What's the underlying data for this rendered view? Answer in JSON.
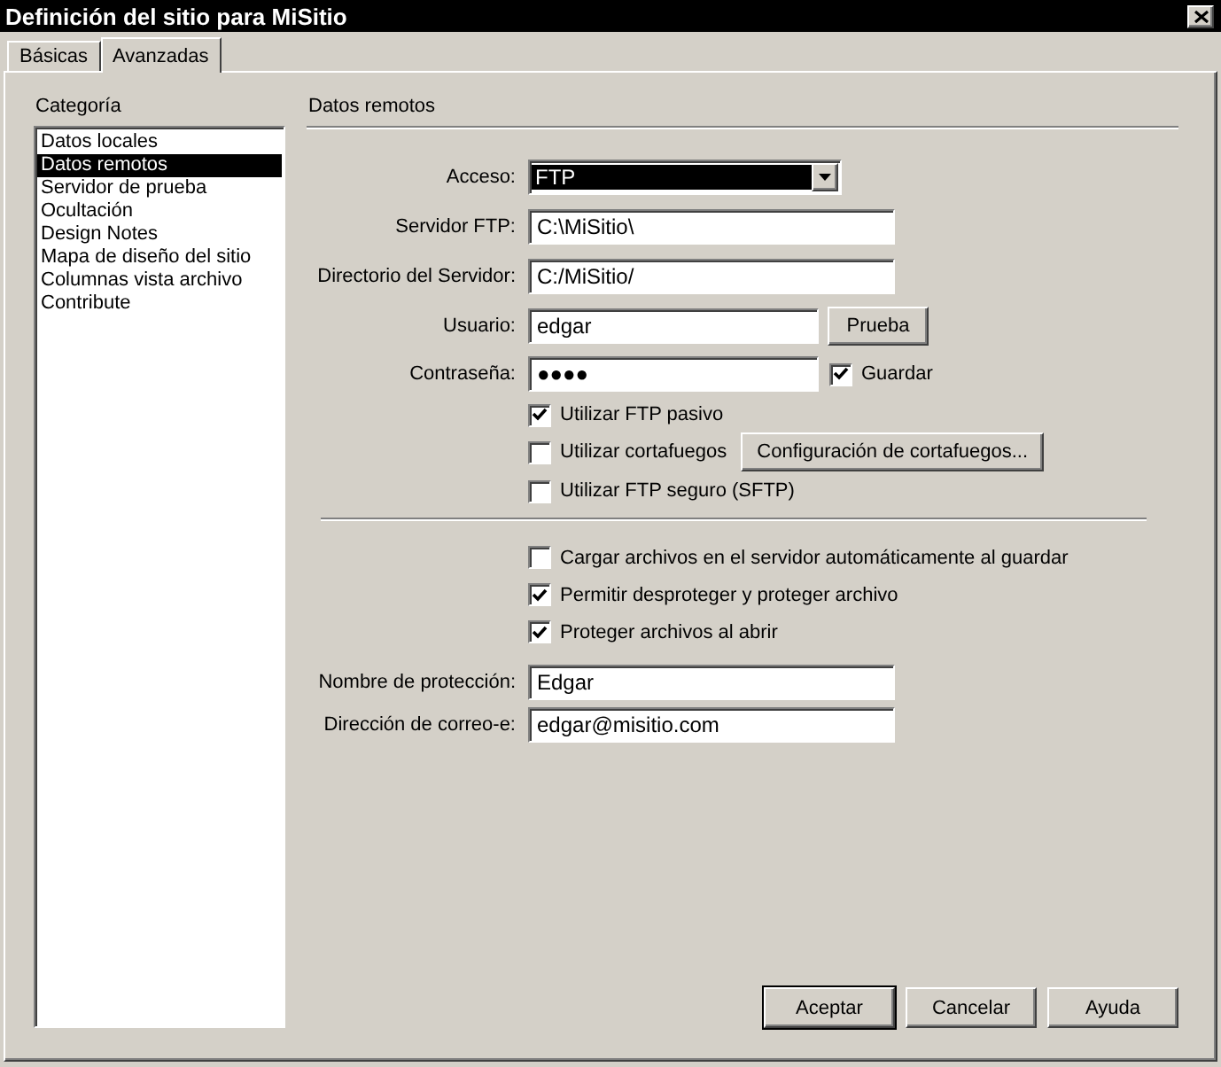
{
  "window": {
    "title": "Definición del sitio para MiSitio"
  },
  "tabs": [
    {
      "label": "Básicas",
      "selected": false
    },
    {
      "label": "Avanzadas",
      "selected": true
    }
  ],
  "category": {
    "label": "Categoría",
    "items": [
      {
        "label": "Datos locales",
        "selected": false
      },
      {
        "label": "Datos remotos",
        "selected": true
      },
      {
        "label": "Servidor de prueba",
        "selected": false
      },
      {
        "label": "Ocultación",
        "selected": false
      },
      {
        "label": "Design Notes",
        "selected": false
      },
      {
        "label": "Mapa de diseño del sitio",
        "selected": false
      },
      {
        "label": "Columnas vista archivo",
        "selected": false
      },
      {
        "label": "Contribute",
        "selected": false
      }
    ]
  },
  "section": {
    "title": "Datos remotos"
  },
  "server_fields": [
    {
      "kind": "select",
      "label": "Acceso:",
      "value": "FTP"
    },
    {
      "kind": "text",
      "label": "Servidor FTP:",
      "value": "C:\\MiSitio\\"
    },
    {
      "kind": "text",
      "label": "Directorio del Servidor:",
      "value": "C:/MiSitio/"
    },
    {
      "kind": "short",
      "label": "Usuario:",
      "value": "edgar",
      "button": "Prueba"
    },
    {
      "kind": "password",
      "label": "Contraseña:",
      "value": "●●●●",
      "checkbox": {
        "label": "Guardar",
        "checked": true
      }
    }
  ],
  "connection_options": [
    {
      "label": "Utilizar FTP pasivo",
      "checked": true
    },
    {
      "label": "Utilizar cortafuegos",
      "checked": false,
      "button": "Configuración de cortafuegos..."
    },
    {
      "label": "Utilizar FTP seguro (SFTP)",
      "checked": false
    }
  ],
  "checkin_options": [
    {
      "label": "Cargar archivos en el servidor automáticamente al guardar",
      "checked": false
    },
    {
      "label": "Permitir desproteger y proteger archivo",
      "checked": true
    },
    {
      "label": "Proteger archivos al abrir",
      "checked": true
    }
  ],
  "checkin_fields": [
    {
      "label": "Nombre de protección:",
      "value": "Edgar"
    },
    {
      "label": "Dirección de correo-e:",
      "value": "edgar@misitio.com"
    }
  ],
  "buttons": [
    {
      "label": "Aceptar",
      "default": true
    },
    {
      "label": "Cancelar",
      "default": false
    },
    {
      "label": "Ayuda",
      "default": false
    }
  ]
}
